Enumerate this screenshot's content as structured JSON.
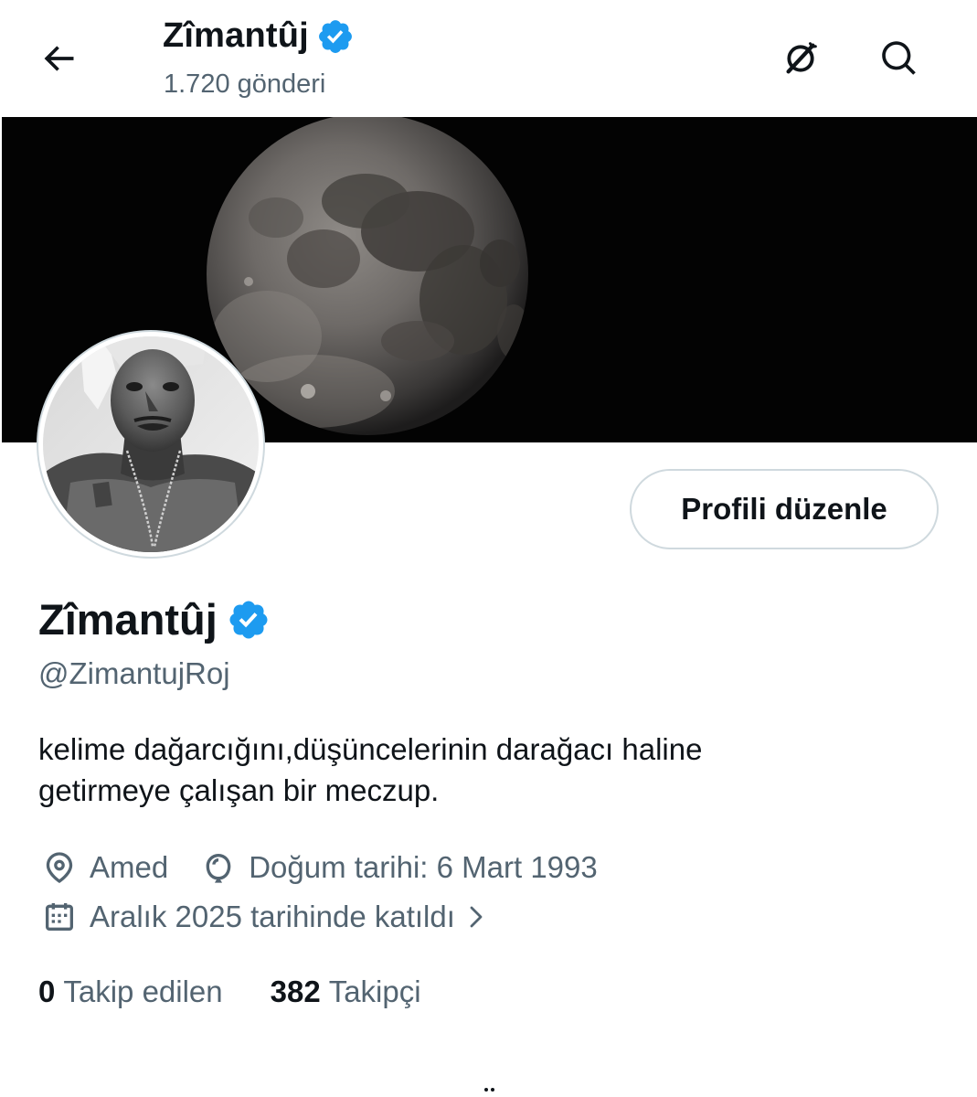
{
  "header": {
    "name": "Zîmantûj",
    "posts": "1.720 gönderi",
    "back_icon": "arrow-left-icon",
    "spaces_icon": "spaces-off-icon",
    "search_icon": "search-icon"
  },
  "profile": {
    "display_name": "Zîmantûj",
    "handle": "@ZimantujRoj",
    "verified": true,
    "bio_lines": [
      "kelime dağarcığını,düşüncelerinin darağacı haline",
      "getirmeye çalışan bir meczup."
    ],
    "location": "Amed",
    "birthday": "Doğum tarihi: 6 Mart 1993",
    "joined": "Aralık 2025 tarihinde katıldı",
    "edit_button": "Profili düzenle"
  },
  "stats": {
    "following_count": "0",
    "following_label": "Takip edilen",
    "followers_count": "382",
    "followers_label": "Takipçi"
  },
  "colors": {
    "text_primary": "#0f1419",
    "text_secondary": "#536471",
    "verified_blue": "#1d9bf0",
    "border": "#cfd9de",
    "banner_bg": "#030303"
  }
}
